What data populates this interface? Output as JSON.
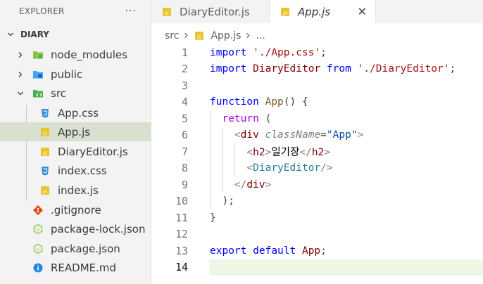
{
  "sidebar": {
    "title": "EXPLORER",
    "more": "···",
    "folder": "DIARY",
    "items": [
      {
        "label": "node_modules",
        "icon": "folder-node-icon"
      },
      {
        "label": "public",
        "icon": "folder-public-icon"
      },
      {
        "label": "src",
        "icon": "folder-src-icon"
      },
      {
        "label": "App.css",
        "icon": "css-file-icon"
      },
      {
        "label": "App.js",
        "icon": "js-file-icon"
      },
      {
        "label": "DiaryEditor.js",
        "icon": "js-file-icon"
      },
      {
        "label": "index.css",
        "icon": "css-file-icon"
      },
      {
        "label": "index.js",
        "icon": "js-file-icon"
      },
      {
        "label": ".gitignore",
        "icon": "git-icon"
      },
      {
        "label": "package-lock.json",
        "icon": "nodejs-file-icon"
      },
      {
        "label": "package.json",
        "icon": "nodejs-file-icon"
      },
      {
        "label": "README.md",
        "icon": "info-icon"
      }
    ]
  },
  "tabs": [
    {
      "label": "DiaryEditor.js",
      "active": false
    },
    {
      "label": "App.js",
      "active": true,
      "close": "✕"
    }
  ],
  "breadcrumb": {
    "segments": [
      "src",
      "App.js",
      "..."
    ]
  },
  "editor": {
    "lines": [
      {
        "n": "1",
        "tokens": [
          [
            "kw2",
            "import"
          ],
          [
            "p",
            " "
          ],
          [
            "str",
            "'./App.css'"
          ],
          [
            "p",
            ";"
          ]
        ]
      },
      {
        "n": "2",
        "tokens": [
          [
            "kw2",
            "import"
          ],
          [
            "p",
            " "
          ],
          [
            "tag",
            "DiaryEditor"
          ],
          [
            "p",
            " "
          ],
          [
            "kw2",
            "from"
          ],
          [
            "p",
            " "
          ],
          [
            "str",
            "'./DiaryEditor'"
          ],
          [
            "p",
            ";"
          ]
        ]
      },
      {
        "n": "3",
        "tokens": []
      },
      {
        "n": "4",
        "tokens": [
          [
            "kw2",
            "function"
          ],
          [
            "p",
            " "
          ],
          [
            "fn",
            "App"
          ],
          [
            "p",
            "() {"
          ]
        ]
      },
      {
        "n": "5",
        "tokens": [
          [
            "p",
            "  "
          ],
          [
            "kw",
            "return"
          ],
          [
            "p",
            " ("
          ]
        ]
      },
      {
        "n": "6",
        "tokens": [
          [
            "p",
            "    "
          ],
          [
            "bracket",
            "<"
          ],
          [
            "tag",
            "div"
          ],
          [
            "p",
            " "
          ],
          [
            "attr",
            "className"
          ],
          [
            "p",
            "="
          ],
          [
            "attrval",
            "\"App\""
          ],
          [
            "bracket",
            ">"
          ]
        ]
      },
      {
        "n": "7",
        "tokens": [
          [
            "p",
            "      "
          ],
          [
            "bracket",
            "<"
          ],
          [
            "tag",
            "h2"
          ],
          [
            "bracket",
            ">"
          ],
          [
            "text",
            "일기장"
          ],
          [
            "bracket",
            "</"
          ],
          [
            "tag",
            "h2"
          ],
          [
            "bracket",
            ">"
          ]
        ]
      },
      {
        "n": "8",
        "tokens": [
          [
            "p",
            "      "
          ],
          [
            "bracket",
            "<"
          ],
          [
            "comp",
            "DiaryEditor"
          ],
          [
            "bracket",
            "/>"
          ]
        ]
      },
      {
        "n": "9",
        "tokens": [
          [
            "p",
            "    "
          ],
          [
            "bracket",
            "</"
          ],
          [
            "tag",
            "div"
          ],
          [
            "bracket",
            ">"
          ]
        ]
      },
      {
        "n": "10",
        "tokens": [
          [
            "p",
            "  );"
          ]
        ]
      },
      {
        "n": "11",
        "tokens": [
          [
            "p",
            "}"
          ]
        ]
      },
      {
        "n": "12",
        "tokens": []
      },
      {
        "n": "13",
        "tokens": [
          [
            "kw2",
            "export"
          ],
          [
            "p",
            " "
          ],
          [
            "kw2",
            "default"
          ],
          [
            "p",
            " "
          ],
          [
            "tag",
            "App"
          ],
          [
            "p",
            ";"
          ]
        ]
      },
      {
        "n": "14",
        "tokens": []
      }
    ],
    "current_line": "14"
  },
  "colors": {
    "selected_row": "#d8e0cf",
    "current_line": "#eef7e6",
    "js_icon": "#e8c62d",
    "css_icon": "#3b8fd9"
  }
}
